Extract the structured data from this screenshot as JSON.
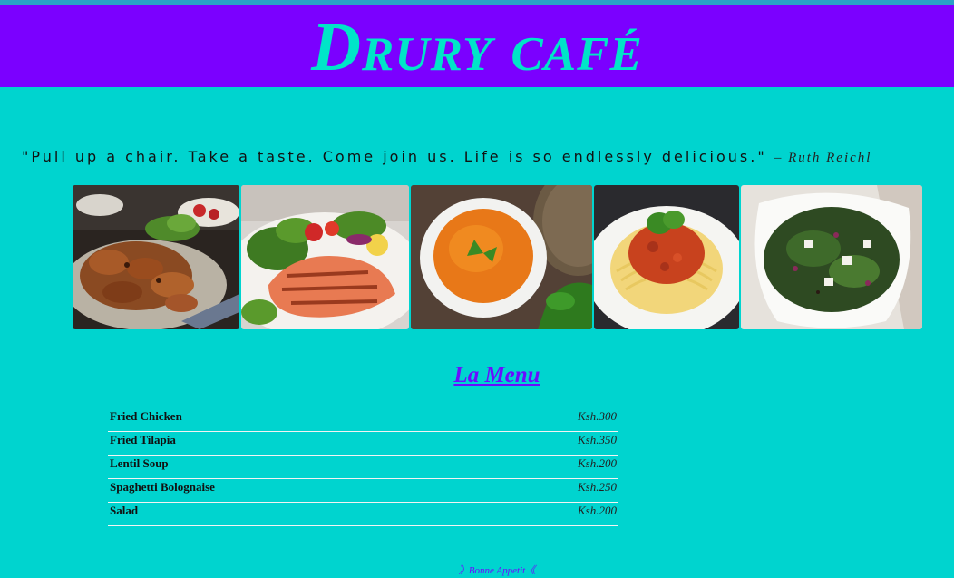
{
  "header": {
    "title": "Drury café"
  },
  "quote": {
    "text": "\"Pull up a chair. Take a taste. Come join us. Life is so endlessly delicious.\"",
    "author": "– Ruth Reichl"
  },
  "gallery": {
    "photos": [
      {
        "icon": "grilled-chicken-photo"
      },
      {
        "icon": "grilled-salmon-photo"
      },
      {
        "icon": "lentil-soup-photo"
      },
      {
        "icon": "spaghetti-bolognaise-photo"
      },
      {
        "icon": "salad-photo"
      }
    ]
  },
  "menu": {
    "title": "La Menu",
    "items": [
      {
        "name": "Fried Chicken",
        "price": "Ksh.300"
      },
      {
        "name": "Fried Tilapia",
        "price": "Ksh.350"
      },
      {
        "name": "Lentil Soup",
        "price": "Ksh.200"
      },
      {
        "name": "Spaghetti Bolognaise",
        "price": "Ksh.250"
      },
      {
        "name": "Salad",
        "price": "Ksh.200"
      }
    ]
  },
  "footer": {
    "note": "》Bonne Appetit《"
  },
  "colors": {
    "background": "#00D4CF",
    "header": "#7B00FF",
    "title": "#00E5C8",
    "accent": "#6A0DFF"
  }
}
